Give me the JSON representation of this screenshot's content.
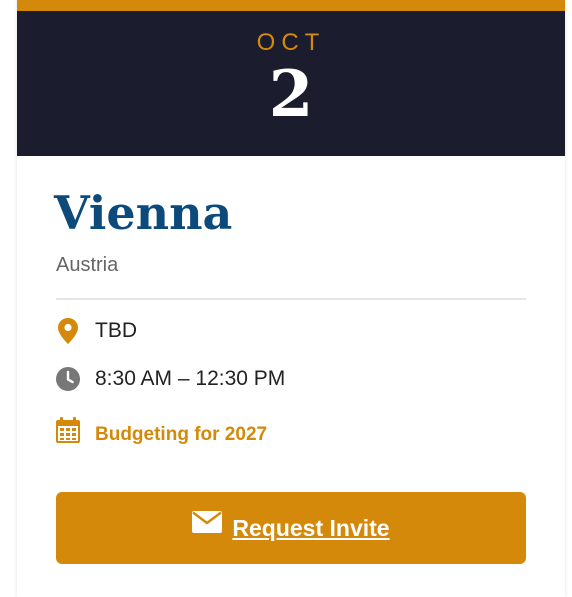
{
  "event": {
    "month": "OCT",
    "day": "2",
    "city": "Vienna",
    "country": "Austria",
    "location": "TBD",
    "time": "8:30 AM – 12:30 PM",
    "topic": "Budgeting for 2027",
    "cta_label": "Request Invite"
  },
  "icons": {
    "location": "map-pin-icon",
    "time": "clock-icon",
    "topic": "calendar-icon",
    "cta": "envelope-icon"
  },
  "colors": {
    "accent": "#d4890a",
    "header_bg": "#1b1c2e",
    "city_text": "#0c4a7c",
    "muted_text": "#666666"
  }
}
